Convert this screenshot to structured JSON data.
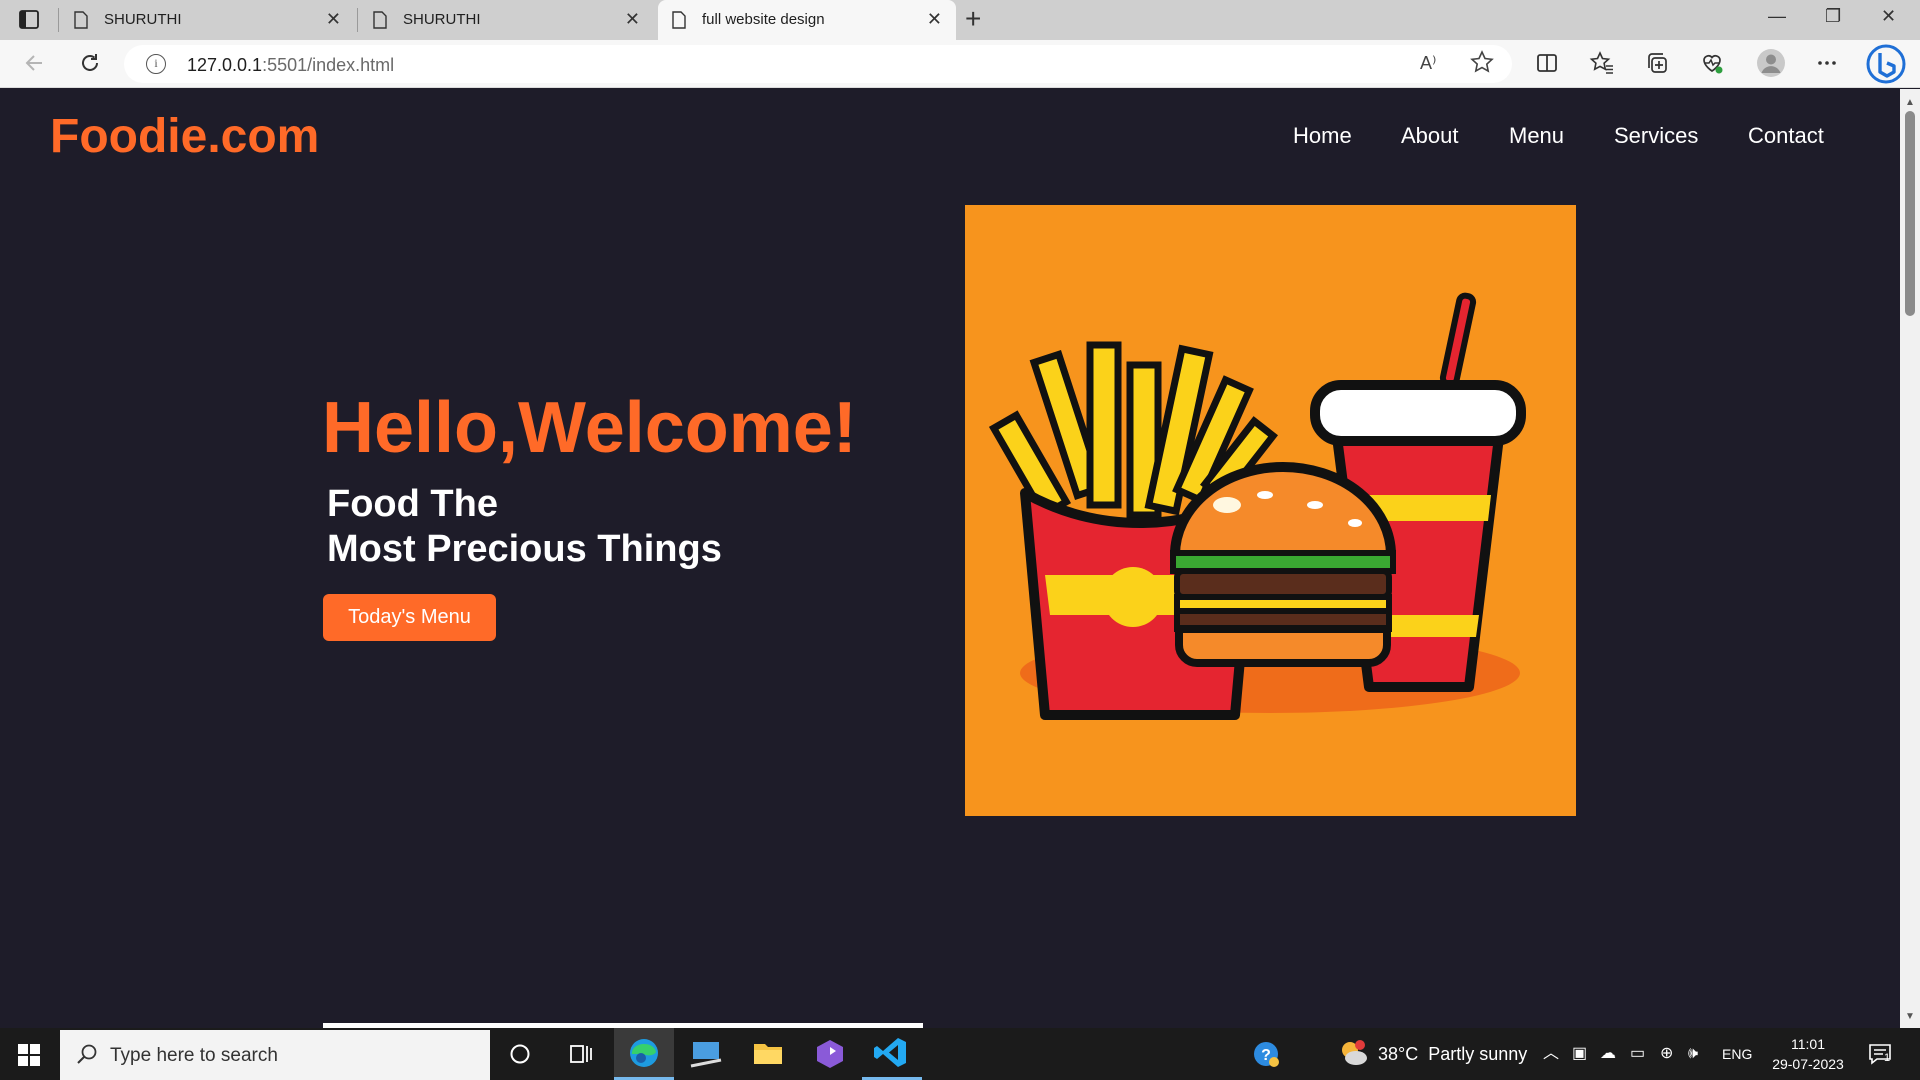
{
  "browser": {
    "tabs": [
      {
        "title": "SHURUTHI",
        "active": false
      },
      {
        "title": "SHURUTHI",
        "active": false
      },
      {
        "title": "full website design",
        "active": true
      }
    ],
    "tab_close_glyph": "✕",
    "new_tab_glyph": "+",
    "window_controls": [
      "—",
      "❐",
      "✕"
    ],
    "address": {
      "host": "127.0.0.1",
      "path": ":5501/index.html"
    },
    "read_aloud_glyph": "A⁾",
    "icons": [
      "tab-actions-icon",
      "back-icon",
      "refresh-icon",
      "info-icon",
      "read-aloud-icon",
      "favorite-star-icon",
      "split-screen-icon",
      "favorites-icon",
      "collections-icon",
      "performance-icon",
      "profile-icon",
      "more-icon",
      "copilot-icon"
    ]
  },
  "site": {
    "logo": "Foodie.com",
    "nav": [
      "Home",
      "About",
      "Menu",
      "Services",
      "Contact"
    ],
    "hero": {
      "title": "Hello,Welcome!",
      "subtitle_line1": "Food The",
      "subtitle_line2": "Most Precious Things",
      "button": "Today's Menu"
    },
    "colors": {
      "background": "#1e1c29",
      "accent": "#ff6a28",
      "image_bg": "#f7941d"
    }
  },
  "taskbar": {
    "search_placeholder": "Type here to search",
    "weather": "38°C  Partly sunny",
    "language": "ENG",
    "time": "11:01",
    "date": "29-07-2023",
    "notification_count": "1",
    "apps": [
      "cortana-icon",
      "task-view-icon",
      "edge-icon",
      "remote-desktop-icon",
      "file-explorer-icon",
      "app-icon",
      "vscode-icon"
    ]
  }
}
